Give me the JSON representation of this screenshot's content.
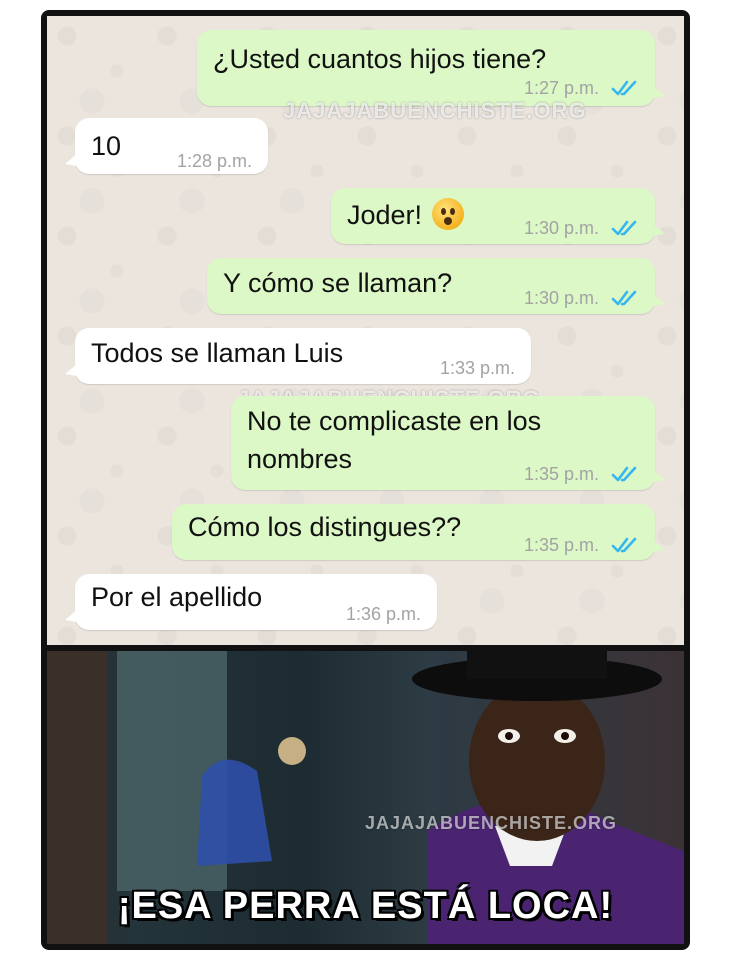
{
  "watermark": "JAJAJABUENCHISTE.ORG",
  "messages": [
    {
      "direction": "out",
      "text": "¿Usted cuantos hijos tiene?",
      "time": "1:27 p.m.",
      "status": "read"
    },
    {
      "direction": "in",
      "text": "10",
      "time": "1:28 p.m."
    },
    {
      "direction": "out",
      "text": "Joder!",
      "emoji": "astonished-face-emoji",
      "time": "1:30 p.m.",
      "status": "read"
    },
    {
      "direction": "out",
      "text": "Y cómo se llaman?",
      "time": "1:30 p.m.",
      "status": "read"
    },
    {
      "direction": "in",
      "text": "Todos se llaman Luis",
      "time": "1:33 p.m."
    },
    {
      "direction": "out",
      "text": "No te complicaste en los",
      "text2": "nombres",
      "time": "1:35 p.m.",
      "status": "read"
    },
    {
      "direction": "out",
      "text": "Cómo los distingues??",
      "time": "1:35 p.m.",
      "status": "read"
    },
    {
      "direction": "in",
      "text": "Por el apellido",
      "time": "1:36 p.m."
    }
  ],
  "meme": {
    "caption": "¡ESA PERRA ESTÁ LOCA!",
    "watermark": "JAJAJABUENCHISTE.ORG"
  },
  "colors": {
    "outgoing_bubble": "#dcf8c6",
    "incoming_bubble": "#ffffff",
    "chat_background": "#ebe5de",
    "read_ticks": "#34b7f1"
  }
}
